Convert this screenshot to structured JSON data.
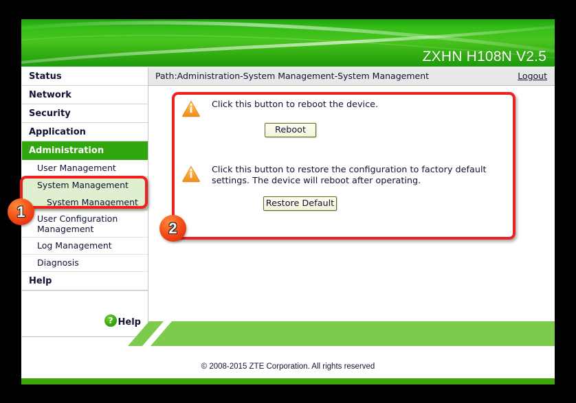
{
  "window": {
    "background_color": "#000000"
  },
  "header": {
    "title": "ZXHN H108N V2.5",
    "brand_green": "#35bd18"
  },
  "pathbar": {
    "path": "Path:Administration-System Management-System Management",
    "logout_label": "Logout"
  },
  "sidebar": {
    "top_items": [
      {
        "label": "Status",
        "active": false
      },
      {
        "label": "Network",
        "active": false
      },
      {
        "label": "Security",
        "active": false
      },
      {
        "label": "Application",
        "active": false
      },
      {
        "label": "Administration",
        "active": true
      }
    ],
    "sub_items": [
      {
        "label": "User Management",
        "highlighted": false
      },
      {
        "label": "System Management",
        "highlighted": true
      },
      {
        "label": "System Management",
        "highlighted": true,
        "level": 2
      },
      {
        "label": "User Configuration Management",
        "highlighted": false
      },
      {
        "label": "Log Management",
        "highlighted": false
      },
      {
        "label": "Diagnosis",
        "highlighted": false
      }
    ],
    "help_item": {
      "label": "Help"
    },
    "help_widget": {
      "icon_glyph": "?",
      "label": "Help"
    }
  },
  "content": {
    "sections": [
      {
        "icon": "warning-triangle-icon",
        "message": "Click this button to reboot the device.",
        "button_label": "Reboot"
      },
      {
        "icon": "warning-triangle-icon",
        "message": "Click this button to restore the configuration to factory default settings. The device will reboot after operating.",
        "button_label": "Restore Default"
      }
    ]
  },
  "footer": {
    "copyright": "© 2008-2015 ZTE Corporation. All rights reserved"
  },
  "annotations": {
    "accent_color": "#ef2020",
    "badges": [
      {
        "number": "1"
      },
      {
        "number": "2"
      }
    ]
  }
}
